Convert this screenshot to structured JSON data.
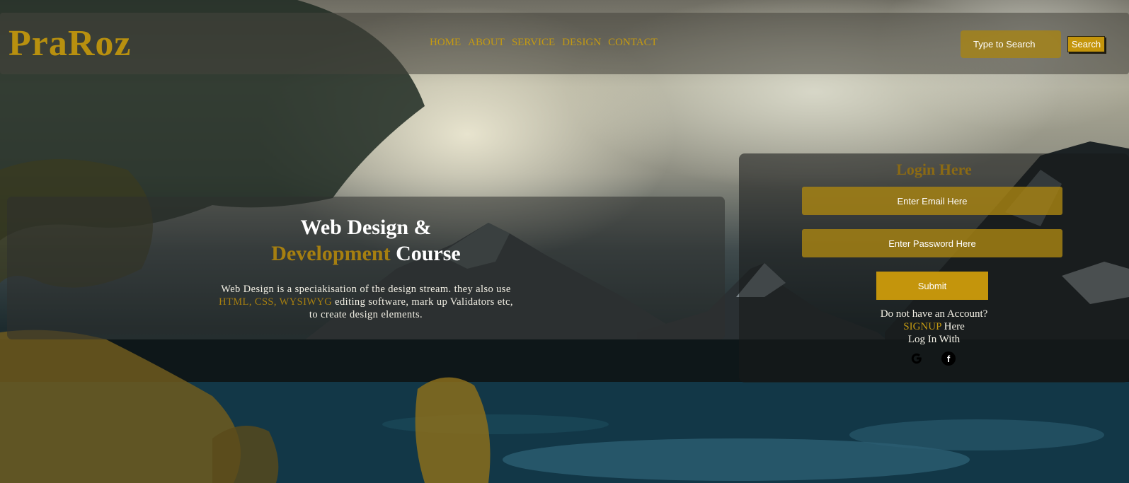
{
  "header": {
    "logo": "PraRoz",
    "nav": [
      "HOME",
      "ABOUT",
      "SERVICE",
      "DESIGN",
      "CONTACT"
    ],
    "search": {
      "placeholder": "Type to Search",
      "button": "Search"
    }
  },
  "course": {
    "title_line1": "Web Design &",
    "title_highlight": "Development",
    "title_rest": " Course",
    "desc_line1": "Web Design is a speciakisation of the design stream. they also use",
    "desc_highlight": "HTML, CSS, WYSIWYG",
    "desc_line2_rest": " editing software, mark up Validators etc,",
    "desc_line3": "to create design elements."
  },
  "login": {
    "title": "Login Here",
    "email_placeholder": "Enter Email Here",
    "password_placeholder": "Enter Password Here",
    "submit": "Submit",
    "no_account": "Do not have an Account?",
    "signup_link": "SIGNUP",
    "signup_suffix": " Here",
    "login_with": "Log In With",
    "social": [
      "google-icon",
      "facebook-icon"
    ]
  },
  "colors": {
    "accent": "#c4950c",
    "dark_gold": "#a67f10",
    "text": "#f4f1e6"
  }
}
